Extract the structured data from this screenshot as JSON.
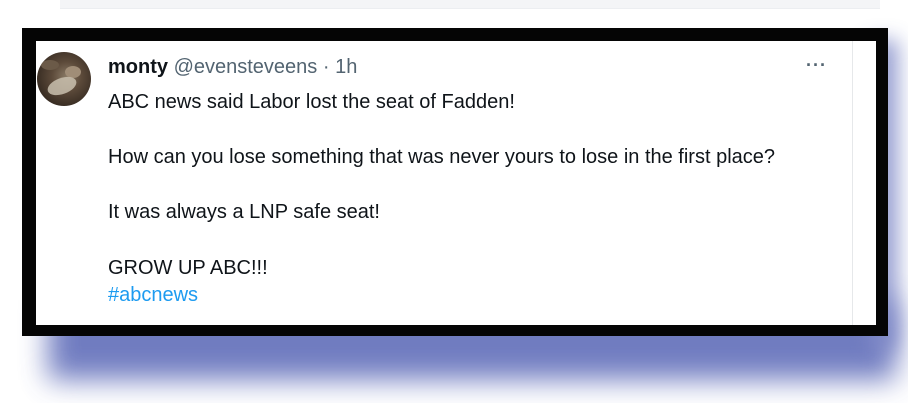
{
  "tweet": {
    "display_name": "monty",
    "handle": "@evensteveens",
    "separator": "·",
    "time": "1h",
    "more_label": "···",
    "lines": [
      "ABC news said Labor lost the seat of Fadden!",
      "How can you lose something that was never yours to lose in the first place?",
      "It was always a LNP safe seat!",
      "GROW UP ABC!!!"
    ],
    "hashtag": "#abcnews"
  },
  "colors": {
    "text": "#0f1419",
    "muted": "#536471",
    "link": "#1d9bf0",
    "frame": "#050505",
    "shadow": "#5866b6"
  },
  "icons": {
    "avatar": "profile-photo",
    "more": "more-options-icon"
  }
}
